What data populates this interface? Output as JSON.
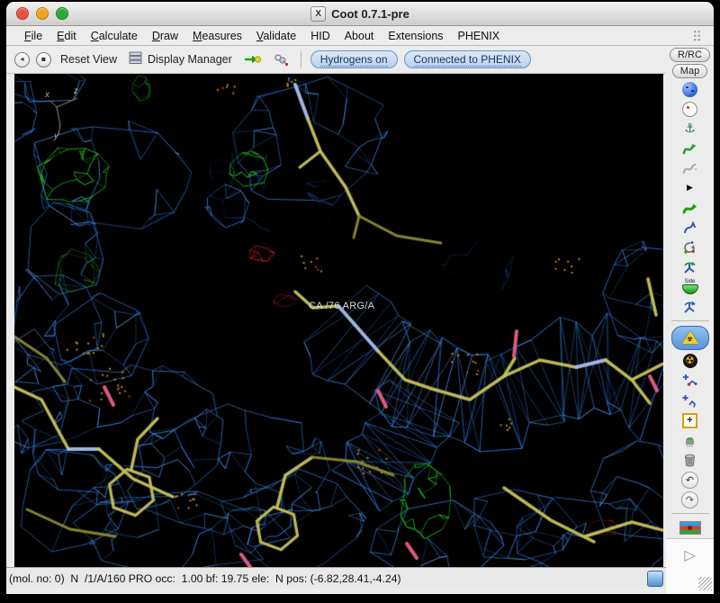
{
  "window": {
    "title": "Coot 0.7.1-pre"
  },
  "menu": {
    "items": [
      {
        "label": "File",
        "mnemonic": true
      },
      {
        "label": "Edit",
        "mnemonic": true
      },
      {
        "label": "Calculate",
        "mnemonic": true
      },
      {
        "label": "Draw",
        "mnemonic": true
      },
      {
        "label": "Measures",
        "mnemonic": true
      },
      {
        "label": "Validate",
        "mnemonic": true
      },
      {
        "label": "HID",
        "mnemonic": false
      },
      {
        "label": "About",
        "mnemonic": false
      },
      {
        "label": "Extensions",
        "mnemonic": false
      },
      {
        "label": "PHENIX",
        "mnemonic": false
      }
    ]
  },
  "toolbar": {
    "reset_view_label": "Reset View",
    "display_manager_label": "Display Manager",
    "hydrogens_label": "Hydrogens on",
    "phenix_label": "Connected to PHENIX"
  },
  "right_panel": {
    "rrc_label": "R/RC",
    "map_label": "Map",
    "side_label": "Side"
  },
  "icons": {
    "x11": "X",
    "back": "◂",
    "target": "▪",
    "anchor": "⚓",
    "triangle": "▶",
    "radiation": "☢",
    "plus": "+",
    "undo": "↶",
    "redo": "↷",
    "play": "▷"
  },
  "viewport": {
    "atom_label": "CA /76 ARG/A",
    "axis_x": "x",
    "axis_y": "y",
    "axis_z": "z",
    "colors": {
      "background": "#000000",
      "density_mesh": "#2f7fe0",
      "density_mesh_bright": "#5d9df0",
      "density_mesh_dim": "#1b4f9a",
      "diff_positive": "#21cc21",
      "diff_positive_dark": "#127a12",
      "diff_negative": "#cc2020",
      "diff_negative_dark": "#7a1515",
      "stick_carbon": "#c9c35a",
      "stick_segment": "#a9bfec",
      "stick_oxygen": "#e85f84",
      "stick_dark": "#8f8a33",
      "water_dots": "#c89a2a",
      "water_dots_alt": "#d04818",
      "axes": "#9aa884",
      "label_text": "#dcdcdc"
    }
  },
  "statusbar": {
    "text": "(mol. no: 0)  N  /1/A/160 PRO occ:  1.00 bf: 19.75 ele:  N pos: (-6.82,28.41,-4.24)"
  }
}
